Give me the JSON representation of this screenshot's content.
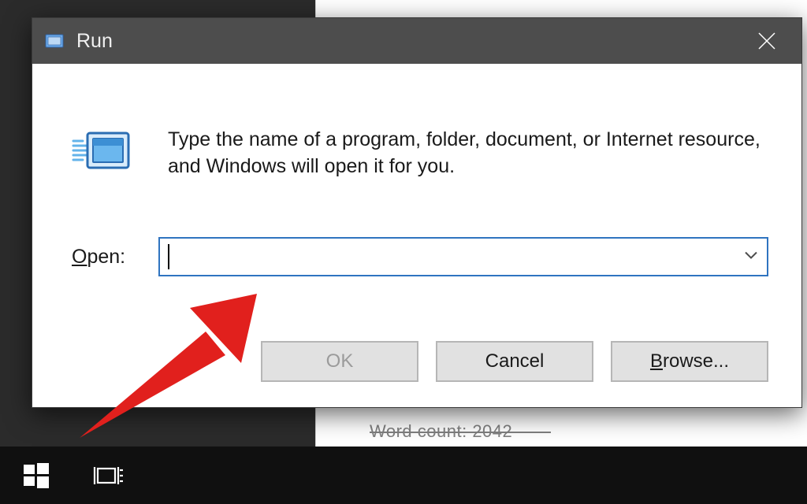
{
  "background": {
    "ghost_text": "Word count: 2042"
  },
  "dialog": {
    "title": "Run",
    "description": "Type the name of a program, folder, document, or Internet resource, and Windows will open it for you.",
    "open_label_underline": "O",
    "open_label_rest": "pen:",
    "input_value": "",
    "buttons": {
      "ok": "OK",
      "cancel": "Cancel",
      "browse_underline": "B",
      "browse_rest": "rowse..."
    }
  }
}
